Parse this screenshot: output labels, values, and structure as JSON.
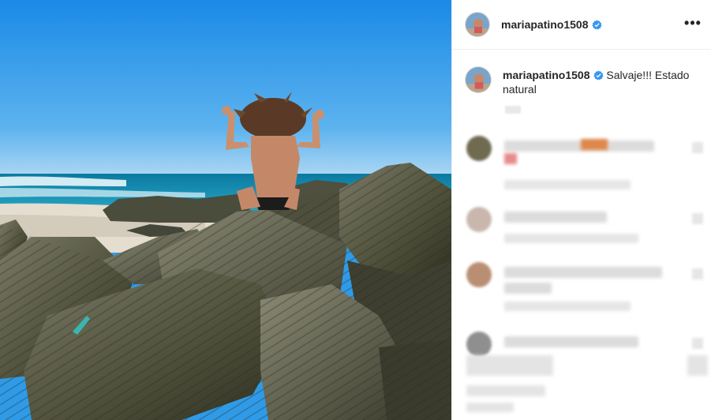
{
  "post": {
    "username": "mariapatino1508",
    "caption": "Salvaje!!! Estado natural",
    "more_icon": "•••"
  },
  "icons": {
    "verified": "verified-badge-icon",
    "more": "more-options-icon"
  },
  "colors": {
    "verified": "#3897f0",
    "sky_top": "#1f8fe8",
    "sky_bottom": "#cfe8f8",
    "sea": "#0f7fa8",
    "rock": "#5a5a48"
  }
}
